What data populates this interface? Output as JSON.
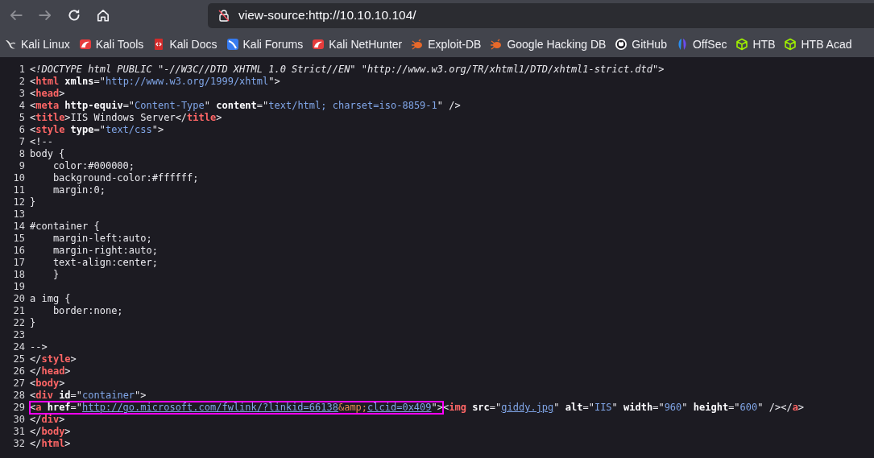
{
  "toolbar": {
    "buttons": [
      {
        "kind": "back",
        "disabled": true
      },
      {
        "kind": "forward",
        "disabled": true
      },
      {
        "kind": "reload",
        "disabled": false
      },
      {
        "kind": "home",
        "disabled": false
      }
    ],
    "address": "view-source:http://10.10.10.104/"
  },
  "bookmarks": [
    {
      "label": "Kali Linux",
      "kind": "dragon"
    },
    {
      "label": "Kali Tools",
      "kind": "kali"
    },
    {
      "label": "Kali Docs",
      "kind": "book"
    },
    {
      "label": "Kali Forums",
      "kind": "forum"
    },
    {
      "label": "Kali NetHunter",
      "kind": "kali"
    },
    {
      "label": "Exploit-DB",
      "kind": "bug"
    },
    {
      "label": "Google Hacking DB",
      "kind": "bug"
    },
    {
      "label": "GitHub",
      "kind": "github"
    },
    {
      "label": "OffSec",
      "kind": "offsec"
    },
    {
      "label": "HTB",
      "kind": "cube"
    },
    {
      "label": "HTB Acad",
      "kind": "cube"
    }
  ],
  "source": [
    {
      "n": "1",
      "tokens": [
        {
          "kind": "doctype",
          "text": "<!DOCTYPE html PUBLIC \"-//W3C//DTD XHTML 1.0 Strict//EN\" \"http://www.w3.org/TR/xhtml1/DTD/xhtml1-strict.dtd\">"
        }
      ]
    },
    {
      "n": "2",
      "tokens": [
        {
          "kind": "punct",
          "text": "<"
        },
        {
          "kind": "tag",
          "text": "html"
        },
        {
          "kind": "attr",
          "text": " xmlns"
        },
        {
          "kind": "punct",
          "text": "=\""
        },
        {
          "kind": "value",
          "text": "http://www.w3.org/1999/xhtml"
        },
        {
          "kind": "punct",
          "text": "\">"
        }
      ]
    },
    {
      "n": "3",
      "tokens": [
        {
          "kind": "punct",
          "text": "<"
        },
        {
          "kind": "tag",
          "text": "head"
        },
        {
          "kind": "punct",
          "text": ">"
        }
      ]
    },
    {
      "n": "4",
      "tokens": [
        {
          "kind": "punct",
          "text": "<"
        },
        {
          "kind": "tag",
          "text": "meta"
        },
        {
          "kind": "attr",
          "text": " http-equiv"
        },
        {
          "kind": "punct",
          "text": "=\""
        },
        {
          "kind": "value",
          "text": "Content-Type"
        },
        {
          "kind": "punct",
          "text": "\" "
        },
        {
          "kind": "attr",
          "text": "content"
        },
        {
          "kind": "punct",
          "text": "=\""
        },
        {
          "kind": "value",
          "text": "text/html; charset=iso-8859-1"
        },
        {
          "kind": "punct",
          "text": "\" />"
        }
      ]
    },
    {
      "n": "5",
      "tokens": [
        {
          "kind": "punct",
          "text": "<"
        },
        {
          "kind": "tag",
          "text": "title"
        },
        {
          "kind": "punct",
          "text": ">IIS Windows Server</"
        },
        {
          "kind": "tag",
          "text": "title"
        },
        {
          "kind": "punct",
          "text": ">"
        }
      ]
    },
    {
      "n": "6",
      "tokens": [
        {
          "kind": "punct",
          "text": "<"
        },
        {
          "kind": "tag",
          "text": "style"
        },
        {
          "kind": "attr",
          "text": " type"
        },
        {
          "kind": "punct",
          "text": "=\""
        },
        {
          "kind": "value",
          "text": "text/css"
        },
        {
          "kind": "punct",
          "text": "\">"
        }
      ]
    },
    {
      "n": "7",
      "tokens": [
        {
          "kind": "punct",
          "text": "<!--"
        }
      ]
    },
    {
      "n": "8",
      "tokens": [
        {
          "kind": "punct",
          "text": "body {"
        }
      ]
    },
    {
      "n": "9",
      "tokens": [
        {
          "kind": "punct",
          "text": "    color:#000000;"
        }
      ]
    },
    {
      "n": "10",
      "tokens": [
        {
          "kind": "punct",
          "text": "    background-color:#ffffff;"
        }
      ]
    },
    {
      "n": "11",
      "tokens": [
        {
          "kind": "punct",
          "text": "    margin:0;"
        }
      ]
    },
    {
      "n": "12",
      "tokens": [
        {
          "kind": "punct",
          "text": "}"
        }
      ]
    },
    {
      "n": "13"
    },
    {
      "n": "14",
      "tokens": [
        {
          "kind": "punct",
          "text": "#container {"
        }
      ]
    },
    {
      "n": "15",
      "tokens": [
        {
          "kind": "punct",
          "text": "    margin-left:auto;"
        }
      ]
    },
    {
      "n": "16",
      "tokens": [
        {
          "kind": "punct",
          "text": "    margin-right:auto;"
        }
      ]
    },
    {
      "n": "17",
      "tokens": [
        {
          "kind": "punct",
          "text": "    text-align:center;"
        }
      ]
    },
    {
      "n": "18",
      "tokens": [
        {
          "kind": "punct",
          "text": "    }"
        }
      ]
    },
    {
      "n": "19"
    },
    {
      "n": "20",
      "tokens": [
        {
          "kind": "punct",
          "text": "a img {"
        }
      ]
    },
    {
      "n": "21",
      "tokens": [
        {
          "kind": "punct",
          "text": "    border:none;"
        }
      ]
    },
    {
      "n": "22",
      "tokens": [
        {
          "kind": "punct",
          "text": "}"
        }
      ]
    },
    {
      "n": "23"
    },
    {
      "n": "24",
      "tokens": [
        {
          "kind": "punct",
          "text": "-->"
        }
      ]
    },
    {
      "n": "25",
      "tokens": [
        {
          "kind": "punct",
          "text": "</"
        },
        {
          "kind": "tag",
          "text": "style"
        },
        {
          "kind": "punct",
          "text": ">"
        }
      ]
    },
    {
      "n": "26",
      "tokens": [
        {
          "kind": "punct",
          "text": "</"
        },
        {
          "kind": "tag",
          "text": "head"
        },
        {
          "kind": "punct",
          "text": ">"
        }
      ]
    },
    {
      "n": "27",
      "tokens": [
        {
          "kind": "punct",
          "text": "<"
        },
        {
          "kind": "tag",
          "text": "body"
        },
        {
          "kind": "punct",
          "text": ">"
        }
      ]
    },
    {
      "n": "28",
      "tokens": [
        {
          "kind": "punct",
          "text": "<"
        },
        {
          "kind": "tag",
          "text": "div"
        },
        {
          "kind": "attr",
          "text": " id"
        },
        {
          "kind": "punct",
          "text": "=\""
        },
        {
          "kind": "value",
          "text": "container"
        },
        {
          "kind": "punct",
          "text": "\">"
        }
      ]
    },
    {
      "n": "29",
      "boxed_tokens": [
        {
          "kind": "punct",
          "text": "<"
        },
        {
          "kind": "tag",
          "text": "a"
        },
        {
          "kind": "attr",
          "text": " href"
        },
        {
          "kind": "punct",
          "text": "=\""
        },
        {
          "kind": "link",
          "text": "http://go.microsoft.com/fwlink/?linkid=66138"
        },
        {
          "kind": "entity",
          "text": "&amp;"
        },
        {
          "kind": "link",
          "text": "clcid=0x409"
        },
        {
          "kind": "punct",
          "text": "\">"
        }
      ],
      "tokens": [
        {
          "kind": "punct",
          "text": "<"
        },
        {
          "kind": "tag",
          "text": "img"
        },
        {
          "kind": "attr",
          "text": " src"
        },
        {
          "kind": "punct",
          "text": "=\""
        },
        {
          "kind": "link",
          "text": "giddy.jpg"
        },
        {
          "kind": "punct",
          "text": "\" "
        },
        {
          "kind": "attr",
          "text": "alt"
        },
        {
          "kind": "punct",
          "text": "=\""
        },
        {
          "kind": "value",
          "text": "IIS"
        },
        {
          "kind": "punct",
          "text": "\" "
        },
        {
          "kind": "attr",
          "text": "width"
        },
        {
          "kind": "punct",
          "text": "=\""
        },
        {
          "kind": "value",
          "text": "960"
        },
        {
          "kind": "punct",
          "text": "\" "
        },
        {
          "kind": "attr",
          "text": "height"
        },
        {
          "kind": "punct",
          "text": "=\""
        },
        {
          "kind": "value",
          "text": "600"
        },
        {
          "kind": "punct",
          "text": "\" /></"
        },
        {
          "kind": "tag",
          "text": "a"
        },
        {
          "kind": "punct",
          "text": ">"
        }
      ]
    },
    {
      "n": "30",
      "tokens": [
        {
          "kind": "punct",
          "text": "</"
        },
        {
          "kind": "tag",
          "text": "div"
        },
        {
          "kind": "punct",
          "text": ">"
        }
      ]
    },
    {
      "n": "31",
      "tokens": [
        {
          "kind": "punct",
          "text": "</"
        },
        {
          "kind": "tag",
          "text": "body"
        },
        {
          "kind": "punct",
          "text": ">"
        }
      ]
    },
    {
      "n": "32",
      "tokens": [
        {
          "kind": "punct",
          "text": "</"
        },
        {
          "kind": "tag",
          "text": "html"
        },
        {
          "kind": "punct",
          "text": ">"
        }
      ]
    }
  ]
}
